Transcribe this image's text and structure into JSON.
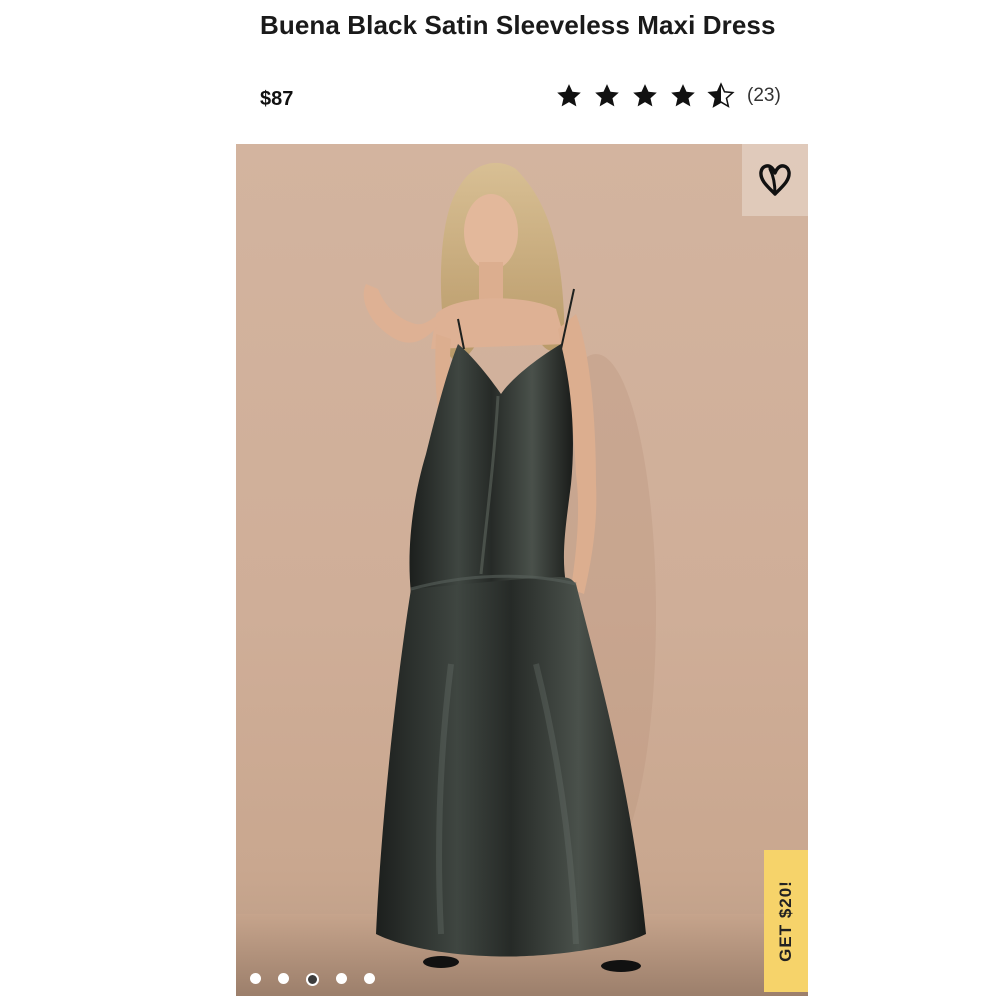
{
  "product": {
    "title": "Buena Black Satin Sleeveless Maxi Dress",
    "price": "$87",
    "rating": 4.5,
    "review_count": "(23)"
  },
  "gallery": {
    "image_alt": "Buena Black Satin Sleeveless Maxi Dress",
    "slides": 5,
    "active_slide": 3,
    "favorite_icon": "heart-icon",
    "promo_label": "GET $20!"
  },
  "colors": {
    "promo_bg": "#f6d36a",
    "photo_bg": "#d3b49f",
    "star": "#111111"
  }
}
